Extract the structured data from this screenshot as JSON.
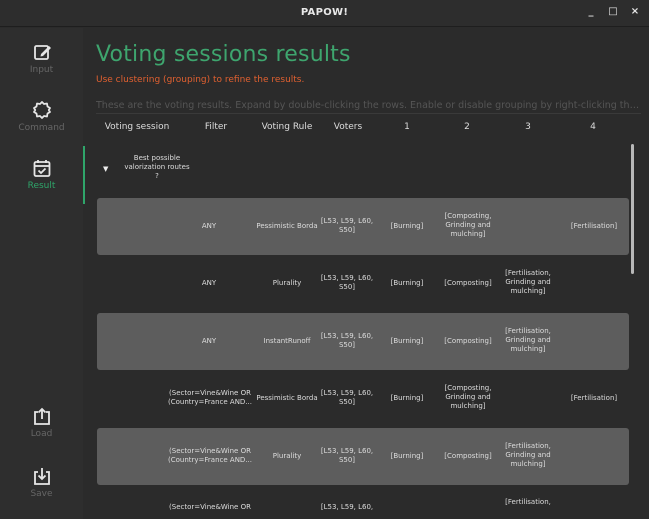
{
  "window": {
    "title": "PAPOW!",
    "minimize": "_",
    "maximize": "□",
    "close": "×"
  },
  "sidebar": {
    "items": [
      {
        "label": "Input",
        "icon": "edit-icon"
      },
      {
        "label": "Command",
        "icon": "gear-icon"
      },
      {
        "label": "Result",
        "icon": "calendar-check-icon"
      },
      {
        "label": "Load",
        "icon": "upload-icon"
      },
      {
        "label": "Save",
        "icon": "download-icon"
      }
    ],
    "active": "Result"
  },
  "main": {
    "title": "Voting sessions results",
    "hint": "Use clustering (grouping) to refine the results.",
    "description": "These are the voting results. Expand by double-clicking the rows. Enable or disable grouping by right-clicking the colum..."
  },
  "table": {
    "columns": [
      "Voting session",
      "Filter",
      "Voting Rule",
      "Voters",
      "1",
      "2",
      "3",
      "4"
    ],
    "group": {
      "label": "Best possible valorization routes ?"
    },
    "rows": [
      {
        "filter": "ANY",
        "rule": "Pessimistic Borda",
        "voters": "[L53, L59, L60, S50]",
        "c1": "[Burning]",
        "c2": "[Composting, Grinding and mulching]",
        "c3": "",
        "c4": "[Fertilisation]"
      },
      {
        "filter": "ANY",
        "rule": "Plurality",
        "voters": "[L53, L59, L60, S50]",
        "c1": "[Burning]",
        "c2": "[Composting]",
        "c3": "[Fertilisation, Grinding and mulching]",
        "c4": ""
      },
      {
        "filter": "ANY",
        "rule": "InstantRunoff",
        "voters": "[L53, L59, L60, S50]",
        "c1": "[Burning]",
        "c2": "[Composting]",
        "c3": "[Fertilisation, Grinding and mulching]",
        "c4": ""
      },
      {
        "filter": "(Sector=Vine&Wine OR (Country=France AND...",
        "rule": "Pessimistic Borda",
        "voters": "[L53, L59, L60, S50]",
        "c1": "[Burning]",
        "c2": "[Composting, Grinding and mulching]",
        "c3": "",
        "c4": "[Fertilisation]"
      },
      {
        "filter": "(Sector=Vine&Wine OR (Country=France AND...",
        "rule": "Plurality",
        "voters": "[L53, L59, L60, S50]",
        "c1": "[Burning]",
        "c2": "[Composting]",
        "c3": "[Fertilisation, Grinding and mulching]",
        "c4": ""
      },
      {
        "filter": "(Sector=Vine&Wine OR",
        "rule": "",
        "voters": "[L53, L59, L60,",
        "c1": "",
        "c2": "",
        "c3": "[Fertilisation,",
        "c4": ""
      }
    ]
  },
  "colors": {
    "accent": "#3ea56e",
    "hint": "#e06030",
    "row_highlight": "#5d5d5d",
    "background": "#2b2b2b"
  }
}
